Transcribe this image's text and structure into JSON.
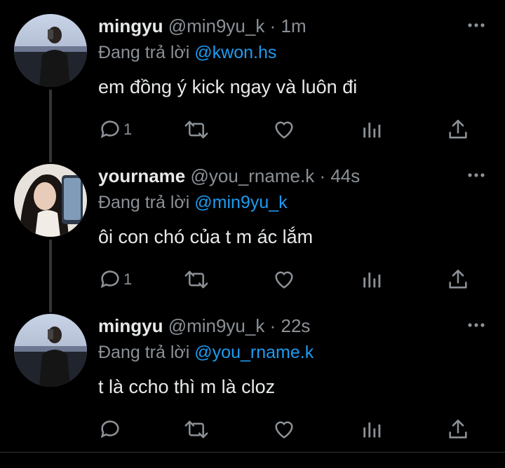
{
  "tweets": [
    {
      "name": "mingyu",
      "handle": "@min9yu_k",
      "sep": "·",
      "time": "1m",
      "replying_prefix": "Đang trả lời",
      "replying_to": "@kwon.hs",
      "text": "em đồng ý kick ngay và luôn đi",
      "reply_count": "1",
      "avatar": "mirror-selfie-man"
    },
    {
      "name": "yourname",
      "handle": "@you_rname.k",
      "sep": "·",
      "time": "44s",
      "replying_prefix": "Đang trả lời",
      "replying_to": "@min9yu_k",
      "text": "ôi con chó của t m ác lắm",
      "reply_count": "1",
      "avatar": "selfie-woman-phone"
    },
    {
      "name": "mingyu",
      "handle": "@min9yu_k",
      "sep": "·",
      "time": "22s",
      "replying_prefix": "Đang trả lời",
      "replying_to": "@you_rname.k",
      "text": "t là ccho thì m là cloz",
      "reply_count": "",
      "avatar": "mirror-selfie-man"
    }
  ],
  "icons": [
    "more-icon",
    "reply-icon",
    "retweet-icon",
    "like-icon",
    "analytics-icon",
    "share-icon"
  ],
  "colors": {
    "background": "#000000",
    "text": "#e7e9ea",
    "muted": "#8b9197",
    "link": "#1d9bf0"
  }
}
